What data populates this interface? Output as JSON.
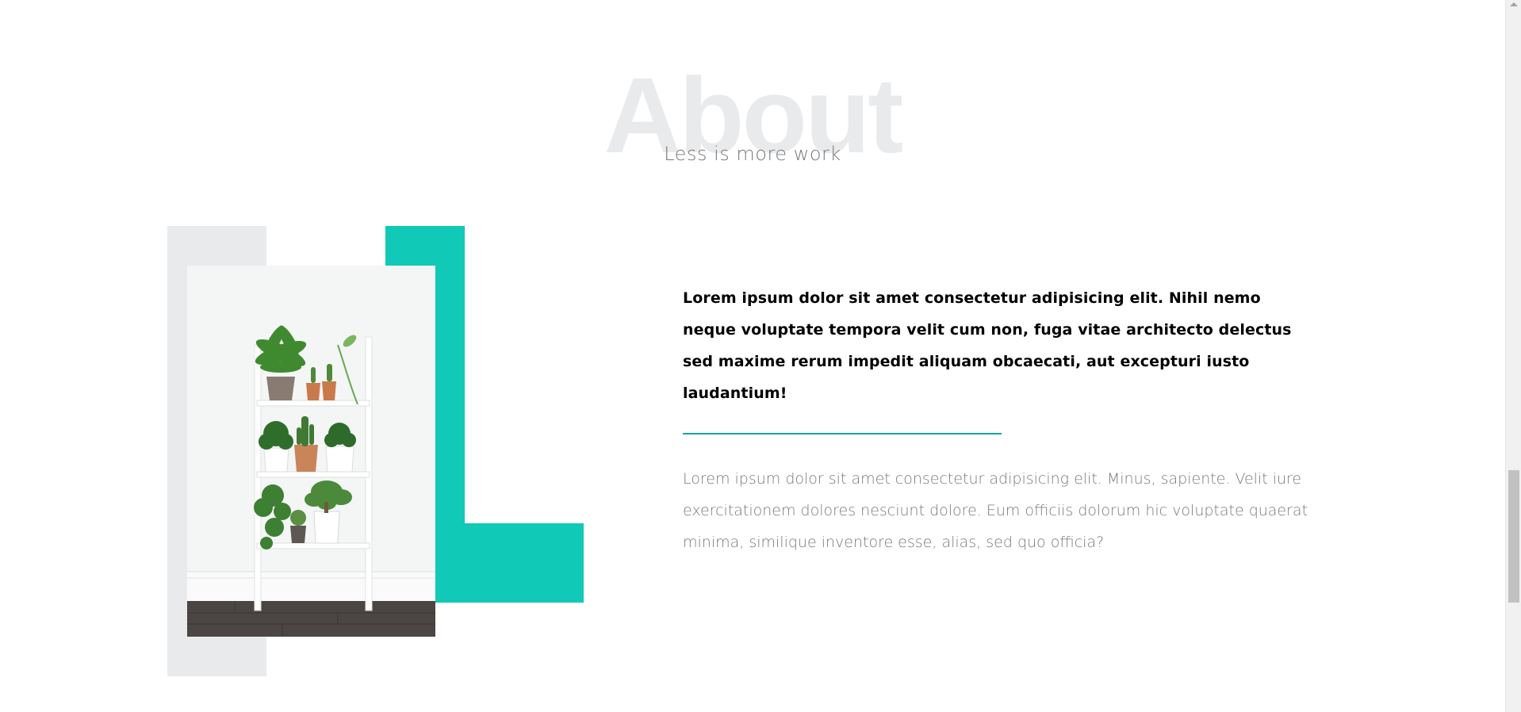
{
  "section": {
    "background_title": "About",
    "subtitle": "Less is more work"
  },
  "content": {
    "lead": "Lorem ipsum dolor sit amet consectetur adipisicing elit. Nihil nemo neque voluptate tempora velit cum non, fuga vitae architecto delectus sed maxime rerum impedit aliquam obcaecati, aut excepturi iusto laudantium!",
    "body": "Lorem ipsum dolor sit amet consectetur adipisicing elit. Minus, sapiente. Velit iure exercitationem dolores nesciunt dolore. Eum officiis dolorum hic voluptate quaerat minima, similique inventore esse, alias, sed quo officia?"
  },
  "image": {
    "icon": "plant-shelf-photo"
  },
  "colors": {
    "accent": "#10c9b7",
    "divider": "#10a99a",
    "decor_grey": "#e9eaec",
    "heading_ghost": "#e9eaec",
    "muted_text": "#7a7a7a"
  }
}
